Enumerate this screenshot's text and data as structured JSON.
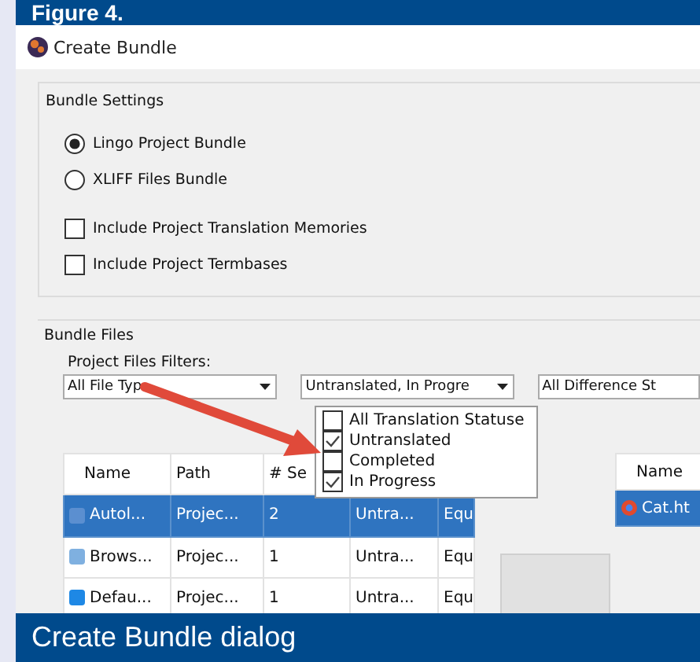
{
  "figure_header": {
    "title": "Figure 4."
  },
  "window": {
    "title": "Create Bundle"
  },
  "bundle_settings": {
    "title": "Bundle Settings",
    "bundle_types": [
      {
        "label": "Lingo Project Bundle",
        "selected": true
      },
      {
        "label": "XLIFF Files Bundle",
        "selected": false
      }
    ],
    "options": [
      {
        "label": "Include Project Translation Memories",
        "checked": false
      },
      {
        "label": "Include Project Termbases",
        "checked": false
      }
    ]
  },
  "bundle_files": {
    "title": "Bundle Files",
    "filters_label": "Project Files Filters:",
    "filters": [
      {
        "value": "All File Typ"
      },
      {
        "value": "Untranslated, In Progre"
      },
      {
        "value": "All Difference St"
      }
    ],
    "status_dropdown": {
      "items": [
        {
          "label": "All Translation Statuse",
          "checked": false
        },
        {
          "label": "Untranslated",
          "checked": true
        },
        {
          "label": "Completed",
          "checked": false
        },
        {
          "label": "In Progress",
          "checked": true
        }
      ]
    },
    "project_files": {
      "columns": [
        "Name",
        "Path",
        "# Se"
      ],
      "rows": [
        {
          "cells": [
            "Autol...",
            "Projec...",
            "2",
            "Untra...",
            "Equ"
          ],
          "selected": true
        },
        {
          "cells": [
            "Brows...",
            "Projec...",
            "1",
            "Untra...",
            "Equ"
          ],
          "selected": false
        },
        {
          "cells": [
            "Defau...",
            "Projec...",
            "1",
            "Untra...",
            "Equ"
          ],
          "selected": false
        }
      ]
    },
    "bundle_list": {
      "columns": [
        "Name"
      ],
      "rows": [
        {
          "cells": [
            "Cat.ht"
          ],
          "selected": true
        }
      ]
    }
  },
  "caption": {
    "text": "Create Bundle dialog"
  }
}
